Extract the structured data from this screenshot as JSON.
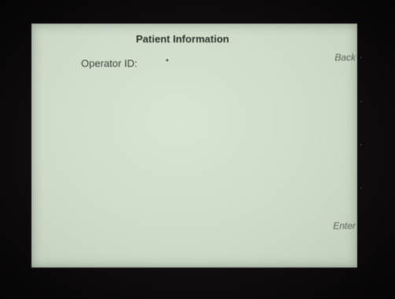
{
  "screen": {
    "title": "Patient Information",
    "operator_id": {
      "label": "Operator ID:",
      "value": "."
    },
    "softkeys": {
      "back": "Back",
      "enter": "Enter"
    }
  }
}
